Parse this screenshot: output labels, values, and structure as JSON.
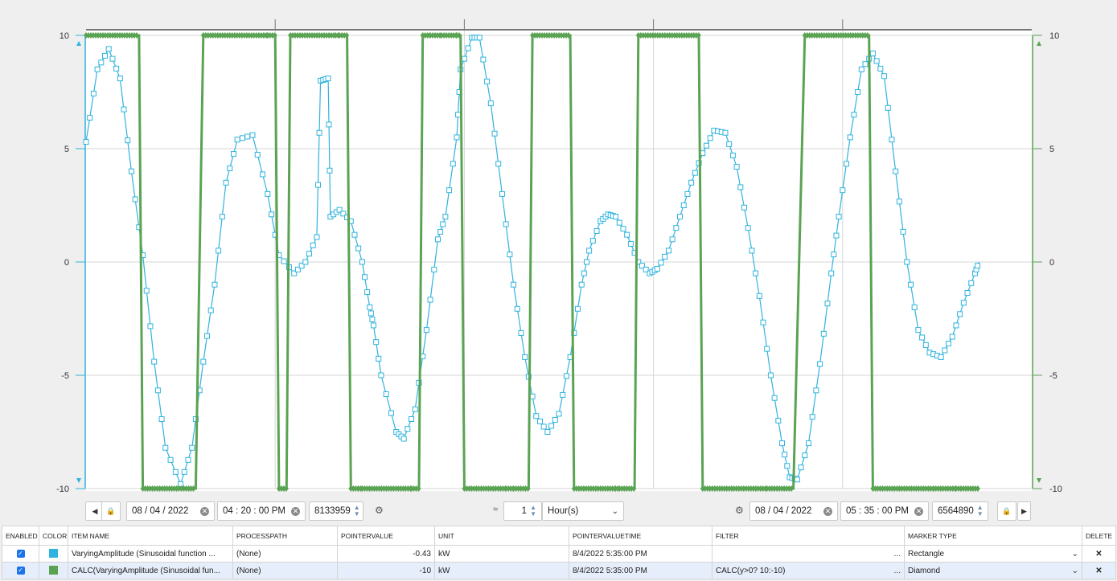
{
  "colors": {
    "series1": "#30b3de",
    "series2": "#5aa353",
    "left_axis": "#30b3de",
    "right_axis": "#5aa353"
  },
  "chart_data": {
    "type": "line",
    "y_axis_left": {
      "ticks": [
        10,
        5,
        0,
        -5,
        -10
      ],
      "range": [
        -10,
        10
      ]
    },
    "y_axis_right": {
      "ticks": [
        10,
        5,
        0,
        -5,
        -10
      ],
      "range": [
        -10,
        10
      ]
    },
    "x_range_hours": [
      0,
      1.25
    ],
    "series": [
      {
        "marker": "square",
        "points": [
          [
            0,
            5.3
          ],
          [
            0.015,
            8.5
          ],
          [
            0.03,
            9.4
          ],
          [
            0.045,
            8.1
          ],
          [
            0.06,
            4.0
          ],
          [
            0.075,
            0.3
          ],
          [
            0.09,
            -4.4
          ],
          [
            0.105,
            -8.2
          ],
          [
            0.125,
            -9.8
          ],
          [
            0.14,
            -8.2
          ],
          [
            0.155,
            -4.4
          ],
          [
            0.17,
            -1.0
          ],
          [
            0.185,
            3.5
          ],
          [
            0.2,
            5.4
          ],
          [
            0.22,
            5.6
          ],
          [
            0.24,
            3.0
          ],
          [
            0.255,
            0.3
          ],
          [
            0.275,
            -0.5
          ],
          [
            0.29,
            0.0
          ],
          [
            0.305,
            1.1
          ],
          [
            0.31,
            8.0
          ],
          [
            0.32,
            8.1
          ],
          [
            0.323,
            2.0
          ],
          [
            0.335,
            2.3
          ],
          [
            0.35,
            1.8
          ],
          [
            0.365,
            0.0
          ],
          [
            0.375,
            -2.0
          ],
          [
            0.38,
            -2.8
          ],
          [
            0.39,
            -5.0
          ],
          [
            0.41,
            -7.5
          ],
          [
            0.42,
            -7.8
          ],
          [
            0.435,
            -6.5
          ],
          [
            0.45,
            -3.0
          ],
          [
            0.465,
            1.0
          ],
          [
            0.475,
            2.0
          ],
          [
            0.49,
            5.5
          ],
          [
            0.495,
            8.5
          ],
          [
            0.51,
            9.9
          ],
          [
            0.52,
            9.9
          ],
          [
            0.535,
            7.0
          ],
          [
            0.55,
            3.0
          ],
          [
            0.565,
            -1.0
          ],
          [
            0.58,
            -4.2
          ],
          [
            0.595,
            -6.8
          ],
          [
            0.61,
            -7.5
          ],
          [
            0.625,
            -6.7
          ],
          [
            0.64,
            -4.2
          ],
          [
            0.655,
            -1.0
          ],
          [
            0.665,
            0.5
          ],
          [
            0.68,
            1.8
          ],
          [
            0.69,
            2.1
          ],
          [
            0.7,
            2.0
          ],
          [
            0.715,
            1.2
          ],
          [
            0.73,
            0.0
          ],
          [
            0.745,
            -0.5
          ],
          [
            0.755,
            -0.3
          ],
          [
            0.77,
            0.5
          ],
          [
            0.785,
            2.0
          ],
          [
            0.8,
            3.5
          ],
          [
            0.815,
            4.8
          ],
          [
            0.83,
            5.8
          ],
          [
            0.845,
            5.7
          ],
          [
            0.86,
            4.2
          ],
          [
            0.875,
            1.5
          ],
          [
            0.89,
            -1.5
          ],
          [
            0.905,
            -5.0
          ],
          [
            0.92,
            -8.0
          ],
          [
            0.93,
            -9.5
          ],
          [
            0.94,
            -9.6
          ],
          [
            0.955,
            -8.0
          ],
          [
            0.97,
            -4.5
          ],
          [
            0.985,
            -0.5
          ],
          [
            0.995,
            2.0
          ],
          [
            1.01,
            5.5
          ],
          [
            1.025,
            8.5
          ],
          [
            1.04,
            9.2
          ],
          [
            1.055,
            8.2
          ],
          [
            1.07,
            4.0
          ],
          [
            1.085,
            0.0
          ],
          [
            1.1,
            -3.0
          ],
          [
            1.115,
            -4.0
          ],
          [
            1.13,
            -4.2
          ],
          [
            1.145,
            -3.3
          ],
          [
            1.16,
            -1.8
          ],
          [
            1.175,
            -0.5
          ],
          [
            1.18,
            0.0
          ]
        ]
      },
      {
        "marker": "diamond",
        "points": [
          [
            0,
            10
          ],
          [
            0.07,
            10
          ],
          [
            0.075,
            -10
          ],
          [
            0.145,
            -10
          ],
          [
            0.155,
            10
          ],
          [
            0.235,
            10
          ],
          [
            0.24,
            10
          ],
          [
            0.24,
            10
          ],
          [
            0.25,
            10
          ],
          [
            0.255,
            -10
          ],
          [
            0.265,
            -10
          ],
          [
            0.27,
            10
          ],
          [
            0.33,
            10
          ],
          [
            0.335,
            10
          ],
          [
            0.345,
            10
          ],
          [
            0.35,
            -10
          ],
          [
            0.36,
            -10
          ],
          [
            0.365,
            -10
          ],
          [
            0.43,
            -10
          ],
          [
            0.44,
            -10
          ],
          [
            0.445,
            10
          ],
          [
            0.455,
            10
          ],
          [
            0.47,
            10
          ],
          [
            0.49,
            10
          ],
          [
            0.495,
            10
          ],
          [
            0.5,
            -10
          ],
          [
            0.555,
            -10
          ],
          [
            0.565,
            -10
          ],
          [
            0.585,
            -10
          ],
          [
            0.59,
            10
          ],
          [
            0.64,
            10
          ],
          [
            0.645,
            -10
          ],
          [
            0.7,
            -10
          ],
          [
            0.705,
            -10
          ],
          [
            0.725,
            -10
          ],
          [
            0.73,
            10
          ],
          [
            0.81,
            10
          ],
          [
            0.815,
            -10
          ],
          [
            0.9,
            -10
          ],
          [
            0.91,
            -10
          ],
          [
            0.935,
            -10
          ],
          [
            0.95,
            10
          ],
          [
            1.035,
            10
          ],
          [
            1.04,
            -10
          ],
          [
            1.12,
            -10
          ],
          [
            1.15,
            -10
          ],
          [
            1.18,
            -10
          ]
        ]
      }
    ]
  },
  "toolbar": {
    "start_date": "08 / 04 / 2022",
    "start_time": "04 : 20 : 00  PM",
    "start_num": "8133959",
    "interval_value": "1",
    "interval_unit": "Hour(s)",
    "end_date": "08 / 04 / 2022",
    "end_time": "05 : 35 : 00  PM",
    "end_num": "6564890"
  },
  "table": {
    "headers": [
      "ENABLED",
      "COLOR",
      "ITEM NAME",
      "PROCESSPATH",
      "POINTERVALUE",
      "UNIT",
      "POINTERVALUETIME",
      "FILTER",
      "MARKER TYPE",
      "DELETE"
    ],
    "rows": [
      {
        "item_name": "VaryingAmplitude (Sinusoidal function ...",
        "processpath": "(None)",
        "value": "-0.43",
        "unit": "kW",
        "time": "8/4/2022 5:35:00 PM",
        "filter": "",
        "filter_more": "...",
        "marker": "Rectangle"
      },
      {
        "item_name": "CALC(VaryingAmplitude (Sinusoidal fun...",
        "processpath": "(None)",
        "value": "-10",
        "unit": "kW",
        "time": "8/4/2022 5:35:00 PM",
        "filter": "CALC(y>0? 10:-10)",
        "filter_more": "...",
        "marker": "Diamond"
      }
    ]
  }
}
